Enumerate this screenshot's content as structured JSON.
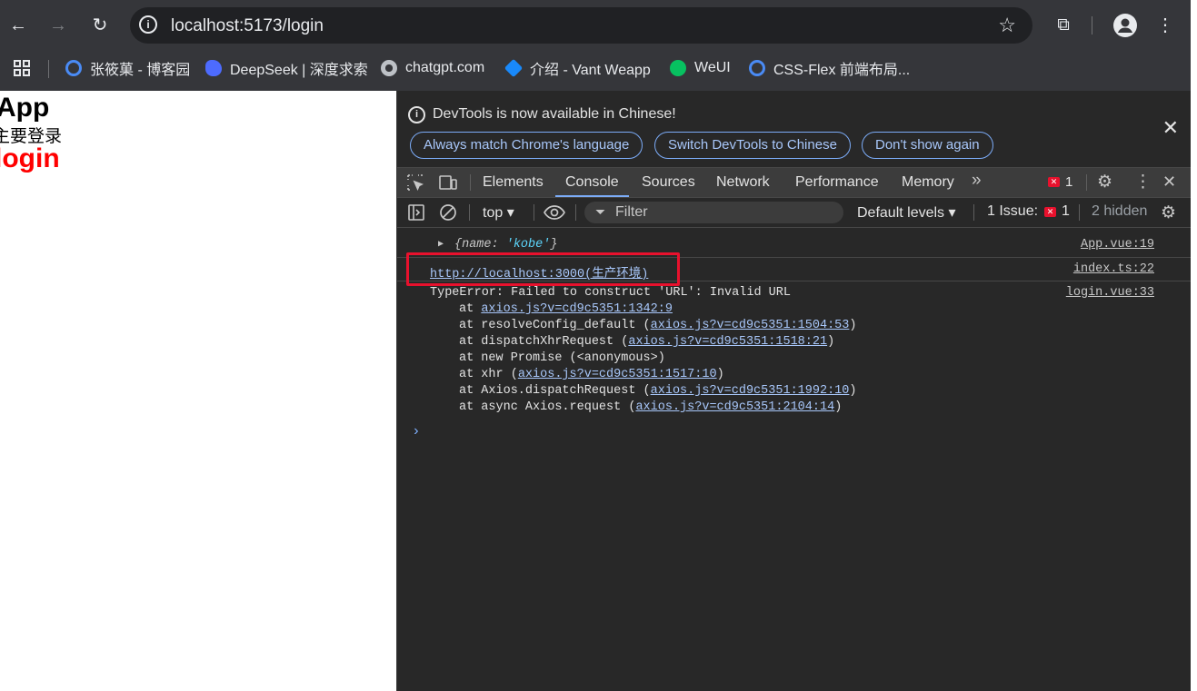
{
  "browser": {
    "url": "localhost:5173/login",
    "bookmarks": [
      {
        "label": "张筱菓 - 博客园",
        "icon": "cnblogs-icon",
        "color": "#4a8bf5"
      },
      {
        "label": "DeepSeek | 深度求索",
        "icon": "deepseek-whale-icon",
        "color": "#4d6bfe"
      },
      {
        "label": "chatgpt.com",
        "icon": "globe-icon",
        "color": "#bdc1c6"
      },
      {
        "label": "介绍 - Vant Weapp",
        "icon": "vant-icon",
        "color": "#1989fa"
      },
      {
        "label": "WeUI",
        "icon": "wechat-icon",
        "color": "#07c160"
      },
      {
        "label": "CSS-Flex 前端布局...",
        "icon": "cnblogs-icon",
        "color": "#4a8bf5"
      }
    ]
  },
  "page": {
    "heading": "App",
    "subtext": "主要登录",
    "login_heading": "login"
  },
  "devtools": {
    "infobar": {
      "message": "DevTools is now available in Chinese!",
      "buttons": [
        "Always match Chrome's language",
        "Switch DevTools to Chinese",
        "Don't show again"
      ]
    },
    "tabs": [
      "Elements",
      "Console",
      "Sources",
      "Network",
      "Performance",
      "Memory"
    ],
    "active_tab": "Console",
    "error_count": "1",
    "toolbar": {
      "context": "top ▾",
      "filter_placeholder": "Filter",
      "levels": "Default levels ▾",
      "issues_label": "1 Issue:",
      "issues_count": "1",
      "hidden": "2 hidden"
    },
    "console": {
      "obj_log": {
        "text_prefix": "{name: ",
        "value": "'kobe'",
        "text_suffix": "}",
        "source": "App.vue:19"
      },
      "url_log": {
        "text": "http://localhost:3000(生产环境)",
        "source": "index.ts:22"
      },
      "error_log": {
        "text": "TypeError: Failed to construct 'URL': Invalid URL",
        "source": "login.vue:33",
        "stack": [
          {
            "prefix": "at ",
            "link": "axios.js?v=cd9c5351:1342:9",
            "suffix": ""
          },
          {
            "prefix": "at resolveConfig_default (",
            "link": "axios.js?v=cd9c5351:1504:53",
            "suffix": ")"
          },
          {
            "prefix": "at dispatchXhrRequest (",
            "link": "axios.js?v=cd9c5351:1518:21",
            "suffix": ")"
          },
          {
            "prefix": "at new Promise (<anonymous>)",
            "link": "",
            "suffix": ""
          },
          {
            "prefix": "at xhr (",
            "link": "axios.js?v=cd9c5351:1517:10",
            "suffix": ")"
          },
          {
            "prefix": "at Axios.dispatchRequest (",
            "link": "axios.js?v=cd9c5351:1992:10",
            "suffix": ")"
          },
          {
            "prefix": "at async Axios.request (",
            "link": "axios.js?v=cd9c5351:2104:14",
            "suffix": ")"
          }
        ]
      },
      "prompt": "›"
    },
    "colors": {
      "error": "#e8112d",
      "accent": "#7cacf8",
      "highlight_box": "#e8112d"
    }
  }
}
